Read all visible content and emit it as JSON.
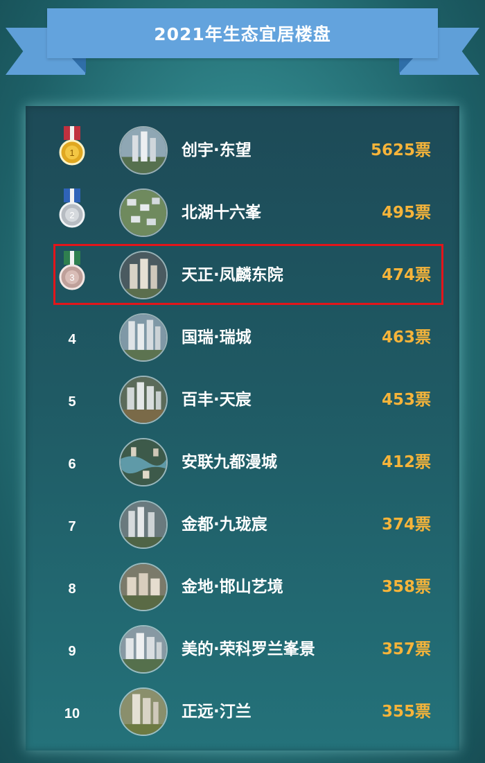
{
  "title": "2021年生态宜居楼盘",
  "colors": {
    "accent_votes": "#f6b43a",
    "ribbon": "#63a3dd",
    "highlight": "#e3151a"
  },
  "rankings": [
    {
      "rank": "1",
      "medal": "gold-medal-icon",
      "medal_number": "1",
      "name": "创宇·东望",
      "votes": "5625票"
    },
    {
      "rank": "2",
      "medal": "silver-medal-icon",
      "medal_number": "2",
      "name": "北湖十六峯",
      "votes": "495票"
    },
    {
      "rank": "3",
      "medal": "bronze-medal-icon",
      "medal_number": "3",
      "name": "天正·凤麟东院",
      "votes": "474票"
    },
    {
      "rank": "4",
      "name": "国瑞·瑞城",
      "votes": "463票"
    },
    {
      "rank": "5",
      "name": "百丰·天宸",
      "votes": "453票"
    },
    {
      "rank": "6",
      "name": "安联九都漫城",
      "votes": "412票"
    },
    {
      "rank": "7",
      "name": "金都·九珑宸",
      "votes": "374票"
    },
    {
      "rank": "8",
      "name": "金地·邯山艺境",
      "votes": "358票"
    },
    {
      "rank": "9",
      "name": "美的·荣科罗兰峯景",
      "votes": "357票"
    },
    {
      "rank": "10",
      "name": "正远·汀兰",
      "votes": "355票"
    }
  ],
  "highlighted_rank": "3"
}
